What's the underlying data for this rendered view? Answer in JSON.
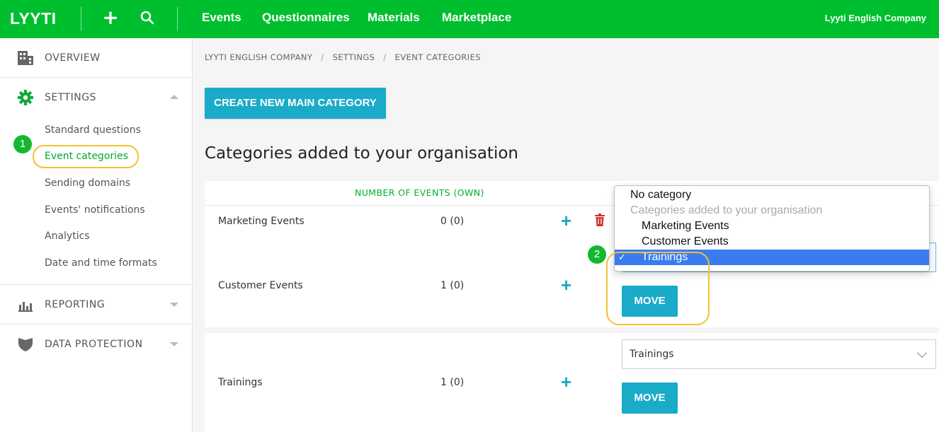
{
  "topbar": {
    "logo": "LYYTI",
    "nav": [
      "Events",
      "Questionnaires",
      "Materials",
      "Marketplace"
    ],
    "company": "Lyyti English Company",
    "plus_icon": "plus-icon",
    "search_icon": "search-icon"
  },
  "sidebar": {
    "overview": "OVERVIEW",
    "settings": "SETTINGS",
    "settings_items": [
      "Standard questions",
      "Event categories",
      "Sending domains",
      "Events' notifications",
      "Analytics",
      "Date and time formats"
    ],
    "reporting": "REPORTING",
    "data_protection": "DATA PROTECTION",
    "step1": "1"
  },
  "breadcrumb": [
    "LYYTI ENGLISH COMPANY",
    "SETTINGS",
    "EVENT CATEGORIES"
  ],
  "breadcrumb_sep": "/",
  "create_button": "CREATE NEW MAIN CATEGORY",
  "section_title": "Categories added to your organisation",
  "table": {
    "col_events": "NUMBER OF EVENTS (OWN)",
    "rows": [
      {
        "name": "Marketing Events",
        "count": "0 (0)"
      },
      {
        "name": "Customer Events",
        "count": "1 (0)"
      },
      {
        "name": "Trainings",
        "count": "1 (0)"
      }
    ]
  },
  "move_label": "MOVE",
  "select_trainings": "Trainings",
  "dropdown": {
    "options": [
      {
        "label": "No category",
        "kind": "option"
      },
      {
        "label": "Categories added to your organisation",
        "kind": "group"
      },
      {
        "label": "Marketing Events",
        "kind": "sub"
      },
      {
        "label": "Customer Events",
        "kind": "sub"
      },
      {
        "label": "Trainings",
        "kind": "sub",
        "selected": true
      }
    ],
    "check": "✓"
  },
  "step2": "2",
  "colors": {
    "brand_green": "#00bf2f",
    "accent_blue": "#1aabc8",
    "highlight": "#f1c232",
    "selected_option": "#3a7bf2"
  }
}
